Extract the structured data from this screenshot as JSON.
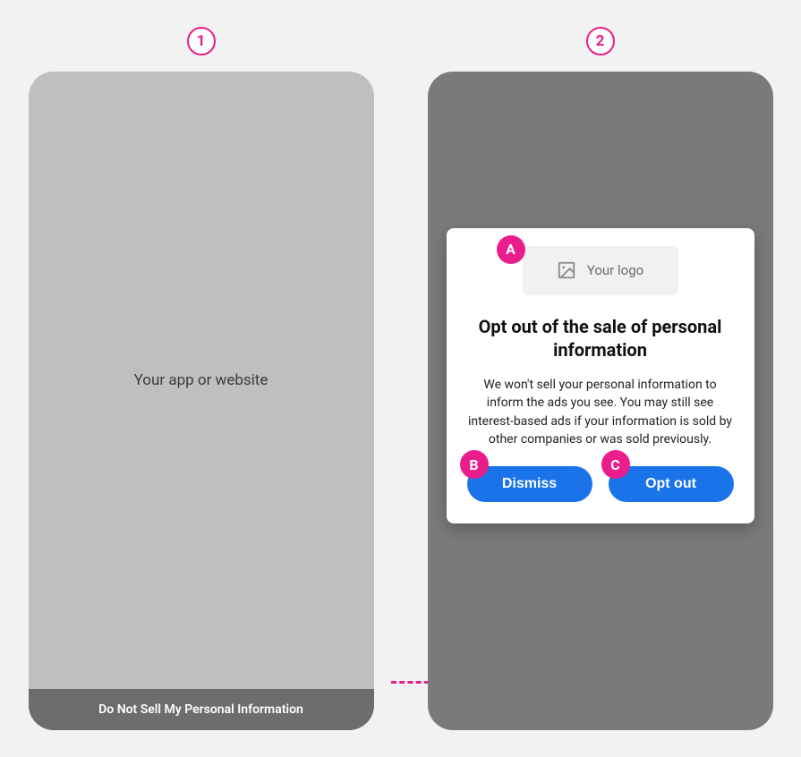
{
  "steps": {
    "step1_label": "1",
    "step2_label": "2"
  },
  "screen1": {
    "placeholder_text": "Your app or website",
    "footer_link": "Do Not Sell My Personal Information"
  },
  "screen2": {
    "modal": {
      "logo_placeholder": "Your logo",
      "title": "Opt out of the sale of personal information",
      "body": "We won't sell your personal information to inform the ads you see. You may still see interest-based ads if your information is sold by other companies or was sold previously.",
      "dismiss_label": "Dismiss",
      "optout_label": "Opt out"
    }
  },
  "callouts": {
    "a": "A",
    "b": "B",
    "c": "C"
  }
}
